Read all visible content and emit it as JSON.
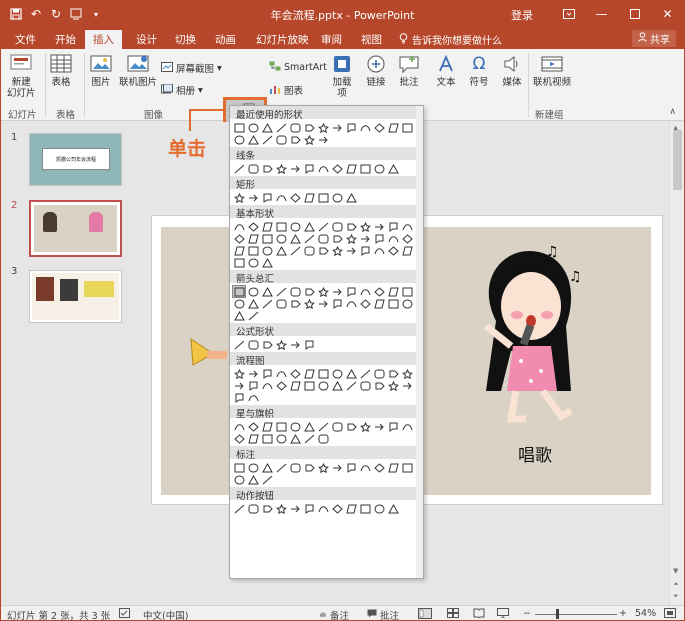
{
  "title_bar": {
    "qat": [
      "save-icon",
      "undo-icon",
      "redo-icon",
      "customize-icon"
    ],
    "document_title": "年会流程.pptx  -  PowerPoint",
    "login": "登录",
    "buttons": [
      "restore-ribbon-icon",
      "minimize-icon",
      "maximize-icon",
      "close-icon"
    ]
  },
  "tabs": {
    "items": [
      "文件",
      "开始",
      "插入",
      "设计",
      "切换",
      "动画",
      "幻灯片放映",
      "审阅",
      "视图"
    ],
    "active": "插入",
    "tell_me": "告诉我你想要做什么",
    "share": "共享"
  },
  "ribbon": {
    "new_slide": "新建\n幻灯片",
    "table": "表格",
    "picture": "图片",
    "online_picture": "联机图片",
    "screenshot": "屏幕截图",
    "album": "相册",
    "shapes": "形状",
    "smartart": "SmartArt",
    "chart": "图表",
    "addins": "加载\n项",
    "link": "链接",
    "comment": "批注",
    "text": "文本",
    "symbol": "符号",
    "media": "媒体",
    "online_video": "联机视频",
    "groups": {
      "slides": "幻灯片",
      "tables": "表格",
      "images": "图像",
      "new_group": "新建组"
    }
  },
  "annotation": "单击",
  "thumbnails": [
    {
      "num": "1",
      "text": "凯撒公司年会流程",
      "selected": false
    },
    {
      "num": "2",
      "text": "",
      "selected": true
    },
    {
      "num": "3",
      "text": "",
      "selected": false
    }
  ],
  "slide": {
    "caption": "唱歌"
  },
  "gallery": {
    "sections": [
      {
        "title": "最近使用的形状",
        "count": 20
      },
      {
        "title": "线条",
        "count": 12
      },
      {
        "title": "矩形",
        "count": 9
      },
      {
        "title": "基本形状",
        "count": 42
      },
      {
        "title": "箭头总汇",
        "count": 28
      },
      {
        "title": "公式形状",
        "count": 6
      },
      {
        "title": "流程图",
        "count": 28
      },
      {
        "title": "星与旗帜",
        "count": 20
      },
      {
        "title": "标注",
        "count": 16
      },
      {
        "title": "动作按钮",
        "count": 12
      }
    ]
  },
  "status": {
    "slide_info": "幻灯片 第 2 张，共 3 张",
    "language": "中文(中国)",
    "notes": "备注",
    "comments": "批注",
    "zoom": "54%"
  },
  "colors": {
    "brand": "#b7472a",
    "annotation": "#e36c2f"
  }
}
